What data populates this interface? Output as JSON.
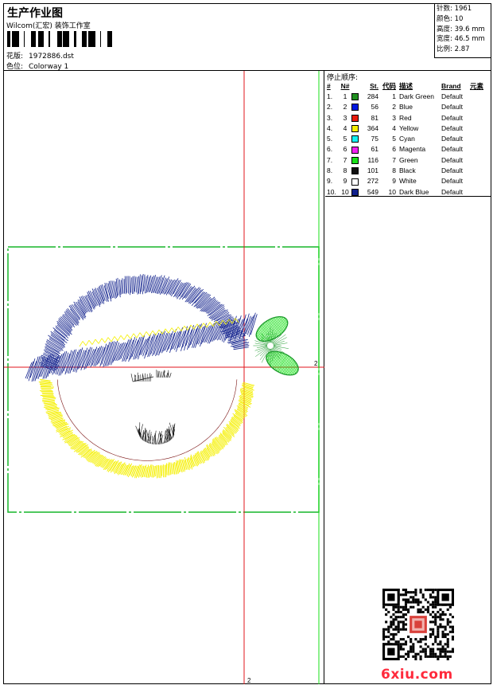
{
  "header": {
    "title": "生产作业图",
    "company": "Wilcom(汇宏) 装饰工作室",
    "design_label": "花版:",
    "design_value": "1972886.dst",
    "colorway_label": "色位:",
    "colorway_value": "Colorway 1"
  },
  "stats": [
    {
      "label": "针数:",
      "value": "1961"
    },
    {
      "label": "颜色:",
      "value": "10"
    },
    {
      "label": "高度:",
      "value": "39.6 mm"
    },
    {
      "label": "宽度:",
      "value": "46.5 mm"
    },
    {
      "label": "比例:",
      "value": "2.87"
    }
  ],
  "stop_sequence": {
    "title": "停止顺序:",
    "headers": {
      "index": "#",
      "number": "N#",
      "stitches": "St.",
      "code": "代码",
      "description": "描述",
      "brand": "Brand",
      "element": "元素"
    },
    "rows": [
      {
        "index": "1.",
        "number": "1",
        "color": "#1f8f1f",
        "stitches": "284",
        "code": "1",
        "description": "Dark Green",
        "brand": "Default"
      },
      {
        "index": "2.",
        "number": "2",
        "color": "#0018e0",
        "stitches": "56",
        "code": "2",
        "description": "Blue",
        "brand": "Default"
      },
      {
        "index": "3.",
        "number": "3",
        "color": "#e81a0c",
        "stitches": "81",
        "code": "3",
        "description": "Red",
        "brand": "Default"
      },
      {
        "index": "4.",
        "number": "4",
        "color": "#f5f000",
        "stitches": "364",
        "code": "4",
        "description": "Yellow",
        "brand": "Default"
      },
      {
        "index": "5.",
        "number": "5",
        "color": "#12f0f0",
        "stitches": "75",
        "code": "5",
        "description": "Cyan",
        "brand": "Default"
      },
      {
        "index": "6.",
        "number": "6",
        "color": "#f020f0",
        "stitches": "61",
        "code": "6",
        "description": "Magenta",
        "brand": "Default"
      },
      {
        "index": "7.",
        "number": "7",
        "color": "#18e018",
        "stitches": "116",
        "code": "7",
        "description": "Green",
        "brand": "Default"
      },
      {
        "index": "8.",
        "number": "8",
        "color": "#101010",
        "stitches": "101",
        "code": "8",
        "description": "Black",
        "brand": "Default"
      },
      {
        "index": "9.",
        "number": "9",
        "color": "#ffffff",
        "stitches": "272",
        "code": "9",
        "description": "White",
        "brand": "Default"
      },
      {
        "index": "10.",
        "number": "10",
        "color": "#10208c",
        "stitches": "549",
        "code": "10",
        "description": "Dark Blue",
        "brand": "Default"
      }
    ]
  },
  "canvas": {
    "axis_label_right": "2",
    "axis_label_bottom": "2"
  },
  "watermark": "6xiu.com",
  "colors": {
    "crosshair": "#e0151b",
    "hoop": "#17b52a",
    "outline_green": "#1c9a2b"
  }
}
